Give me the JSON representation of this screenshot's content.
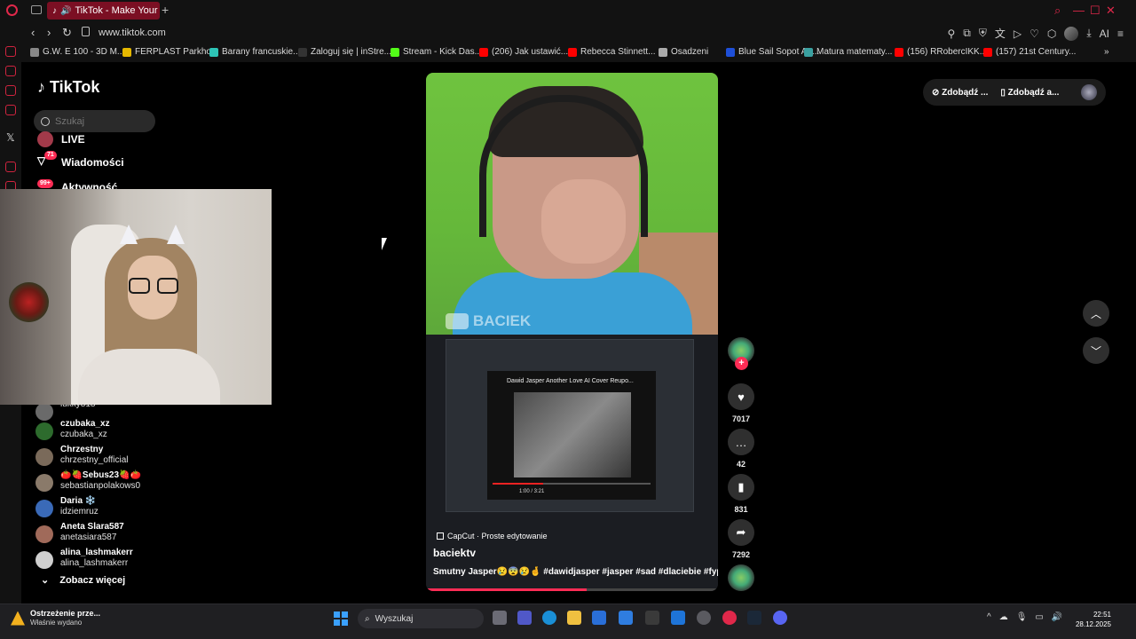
{
  "browser": {
    "tab_title": "TikTok - Make Your Da",
    "url": "www.tiktok.com",
    "bookmarks": [
      {
        "label": "G.W. E 100 - 3D M...",
        "color": "#888888"
      },
      {
        "label": "FERPLAST Parkho...",
        "color": "#e6b800"
      },
      {
        "label": "Barany francuskie...",
        "color": "#2ec4b6"
      },
      {
        "label": "Zaloguj się | inStre...",
        "color": "#333333"
      },
      {
        "label": "Stream - Kick Das...",
        "color": "#53fc18"
      },
      {
        "label": "(206) Jak ustawić...",
        "color": "#ff0000"
      },
      {
        "label": "Rebecca Stinnett...",
        "color": "#ff0000"
      },
      {
        "label": "Osadzeni",
        "color": "#aaaaaa"
      },
      {
        "label": "Blue Sail Sopot Ap...",
        "color": "#1e4fd8"
      },
      {
        "label": "Matura matematy...",
        "color": "#3aa0a0"
      },
      {
        "label": "(156) RRobercIKK...",
        "color": "#ff0000"
      },
      {
        "label": "(157) 21st Century...",
        "color": "#ff0000"
      }
    ]
  },
  "tiktok": {
    "logo": "TikTok",
    "search_placeholder": "Szukaj",
    "menu": {
      "live": "LIVE",
      "messages": "Wiadomości",
      "messages_badge": "71",
      "activity": "Aktywność",
      "activity_badge": "99+"
    },
    "following": [
      {
        "name": "",
        "handle": "lukky818",
        "color": "#6a6a6a"
      },
      {
        "name": "czubaka_xz",
        "handle": "czubaka_xz",
        "color": "#2d6b2d"
      },
      {
        "name": "Chrzestny",
        "handle": "chrzestny_official",
        "color": "#7a6a5a"
      },
      {
        "name": "🍅🍓Sebus23🍓🍅",
        "handle": "sebastianpolakows0",
        "color": "#8a7a6a"
      },
      {
        "name": "Daria ❄️",
        "handle": "idziemruz",
        "color": "#3a6ab8"
      },
      {
        "name": "Aneta Slara587",
        "handle": "anetasiara587",
        "color": "#a06a5a"
      },
      {
        "name": "alina_lashmakerr",
        "handle": "alina_lashmakerr",
        "color": "#cfcfcf"
      }
    ],
    "see_more": "Zobacz więcej",
    "top_right": {
      "coins": "Zdobądź ...",
      "app": "Zdobądź a..."
    },
    "video": {
      "watermark": "BACIEK",
      "inner_title": "Dawid Jasper Another Love AI Cover Reupo...",
      "inner_time": "1:00 / 3:21",
      "capcut": "CapCut · Proste edytowanie",
      "username": "baciektv",
      "description": "Smutny Jasper😢😨😢🤞 #dawidjasper #jasper #sad #dlaciebie #fyp",
      "progress": 0.55
    },
    "actions": {
      "likes": "7017",
      "comments": "42",
      "saves": "831",
      "shares": "7292"
    }
  },
  "taskbar": {
    "notif_title": "Ostrzeżenie prze...",
    "notif_sub": "Właśnie wydano",
    "search": "Wyszukaj",
    "time": "22:51",
    "date": "28.12.2025"
  },
  "colors": {
    "accent": "#fe2c55",
    "opera": "#e0284a",
    "tab_bg": "#7b0f23"
  }
}
